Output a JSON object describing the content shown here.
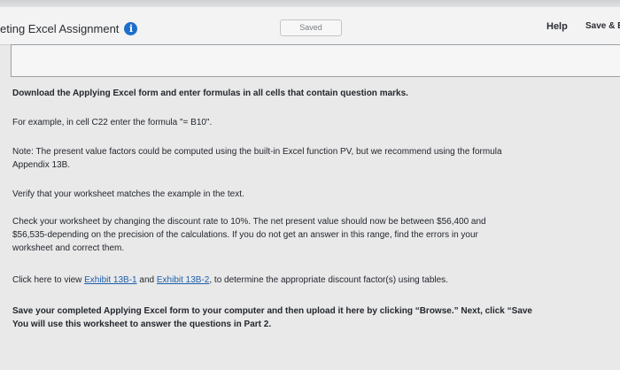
{
  "header": {
    "title": "eting Excel Assignment",
    "info_icon": "i",
    "saved_label": "Saved",
    "help_label": "Help",
    "save_exit_label": "Save & E"
  },
  "content": {
    "instruction": "Download the Applying Excel form and enter formulas in all cells that contain question marks.",
    "example": "For example, in cell C22 enter the formula \"= B10\".",
    "note_line1": "Note: The present value factors could be computed using the built-in Excel function PV, but we recommend using the formula",
    "note_line2": "Appendix 13B.",
    "verify": "Verify that your worksheet matches the example in the text.",
    "check_line1": "Check your worksheet by changing the discount rate to 10%. The net present value should now be between $56,400 and",
    "check_line2": "$56,535-depending on the precision of the calculations. If you do not get an answer in this range, find the errors in your",
    "check_line3": "worksheet and correct them.",
    "click_prefix": "Click here to view ",
    "exhibit1": "Exhibit 13B-1",
    "and_text": " and ",
    "exhibit2": "Exhibit 13B-2",
    "click_suffix": ", to determine the appropriate discount factor(s) using tables.",
    "save_line1": "Save your completed Applying Excel form to your computer and then upload it here by clicking “Browse.” Next, click “Save",
    "save_line2": "You will use this worksheet to answer the questions in Part 2."
  }
}
